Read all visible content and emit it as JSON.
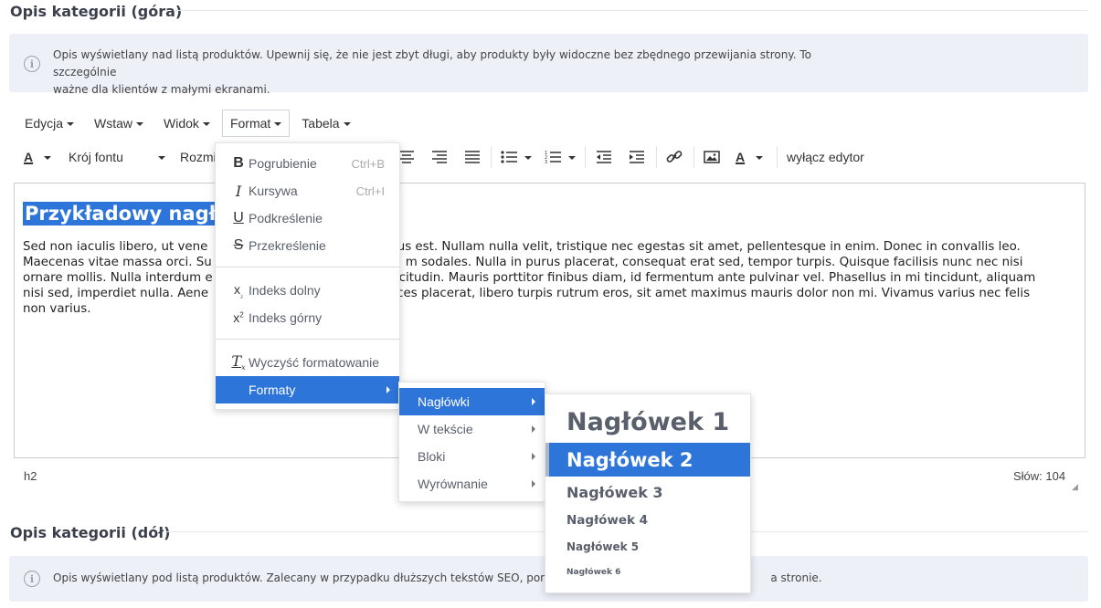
{
  "top_section": {
    "title": "Opis kategorii (góra)",
    "info_line1": "Opis wyświetlany nad listą produktów. Upewnij się, że nie jest zbyt długi, aby produkty były widoczne bez zbędnego przewijania strony. To szczególnie",
    "info_line2": "ważne dla klientów z małymi ekranami."
  },
  "menubar": {
    "edit": "Edycja",
    "insert": "Wstaw",
    "view": "Widok",
    "format": "Format",
    "table": "Tabela"
  },
  "toolbar": {
    "font_family": "Krój fontu",
    "font_size": "Rozmi",
    "disable_editor": "wyłącz edytor"
  },
  "editor": {
    "heading": "Przykładowy nagł",
    "paragraph": "Sed non iaculis libero, ut vene… … …cus est. Nullam nulla velit, tristique nec egestas sit amet, pellentesque in enim. Donec in convallis leo.",
    "p_line1_a": "Sed non iaculis libero, ut vene",
    "p_line1_b": "cus est. Nullam nulla velit, tristique nec egestas sit amet, pellentesque in enim. Donec in convallis leo.",
    "p_line2_a": "Maecenas vitae massa orci. Su",
    "p_line2_b": "m sodales. Nulla in purus placerat, consequat erat sed, tempor turpis. Quisque facilisis nunc nec nisi",
    "p_line3_a": "ornare mollis. Nulla interdum e",
    "p_line3_b": "citudin. Mauris porttitor finibus diam, id fermentum ante pulvinar vel. Phasellus in mi tincidunt, aliquam",
    "p_line4_a": "nisi sed, imperdiet nulla. Aene",
    "p_line4_b": "ces placerat, libero turpis rutrum eros, sit amet maximus mauris dolor non mi. Vivamus varius nec felis",
    "p_line5": "non varius."
  },
  "status": {
    "path": "h2",
    "word_count": "Słów: 104"
  },
  "format_menu": {
    "bold": "Pogrubienie",
    "bold_shortcut": "Ctrl+B",
    "italic": "Kursywa",
    "italic_shortcut": "Ctrl+I",
    "underline": "Podkreślenie",
    "strike": "Przekreślenie",
    "subscript": "Indeks dolny",
    "superscript": "Indeks górny",
    "clear": "Wyczyść formatowanie",
    "formats": "Formaty"
  },
  "formats_menu": {
    "headings": "Nagłówki",
    "inline": "W tekście",
    "blocks": "Bloki",
    "align": "Wyrównanie"
  },
  "headings_menu": {
    "h1": "Nagłówek 1",
    "h2": "Nagłówek 2",
    "h3": "Nagłówek 3",
    "h4": "Nagłówek 4",
    "h5": "Nagłówek 5",
    "h6": "Nagłówek 6"
  },
  "bottom_section": {
    "title": "Opis kategorii (dół)",
    "info_a": "Opis wyświetlany pod listą produktów. Zalecany w przypadku dłuższych tekstów SEO, poniew",
    "info_b": "a stronie."
  },
  "colors": {
    "accent": "#2e75d9",
    "info_bg": "#eef0f8",
    "heading_text": "#595f6b"
  }
}
